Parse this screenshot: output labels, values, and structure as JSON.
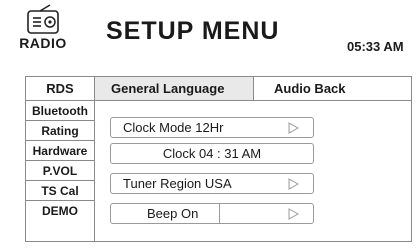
{
  "header": {
    "logo_text": "RADIO",
    "title": "SETUP MENU",
    "time": "05:33 AM"
  },
  "top_tabs": {
    "rds": "RDS",
    "general_language": "General Language",
    "audio_back": "Audio Back"
  },
  "sidebar": {
    "items": [
      {
        "label": "Bluetooth"
      },
      {
        "label": "Rating"
      },
      {
        "label": "Hardware"
      },
      {
        "label": "P.VOL"
      },
      {
        "label": "TS Cal"
      },
      {
        "label": "DEMO"
      }
    ]
  },
  "settings": [
    {
      "label": "Clock Mode 12Hr"
    },
    {
      "label": "Clock 04 : 31 AM"
    },
    {
      "label": "Tuner Region USA"
    },
    {
      "label": "Beep On"
    }
  ],
  "icons": {
    "logo": "radio-icon",
    "arrow": "play-arrow-icon"
  }
}
